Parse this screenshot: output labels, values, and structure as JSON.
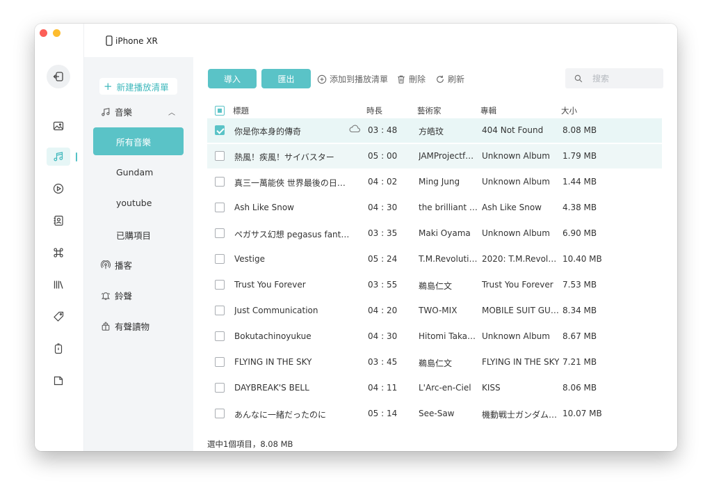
{
  "device": {
    "name": "iPhone XR"
  },
  "sidebar": {
    "new_playlist": "新建播放清單",
    "music": "音樂",
    "all_music": "所有音樂",
    "playlists": [
      "Gundam",
      "youtube",
      "已購項目"
    ],
    "podcasts": "播客",
    "ringtones": "鈴聲",
    "audiobooks": "有聲讀物"
  },
  "toolbar": {
    "import_label": "導入",
    "export_label": "匯出",
    "add_to_playlist": "添加到播放清單",
    "delete": "刪除",
    "refresh": "刷新",
    "search_placeholder": "搜索"
  },
  "table": {
    "columns": {
      "title": "標題",
      "duration": "時長",
      "artist": "藝術家",
      "album": "專輯",
      "size": "大小"
    },
    "rows": [
      {
        "title": "你是你本身的傳奇",
        "duration": "03 : 48",
        "artist": "方皓玟",
        "album": "404 Not Found",
        "size": "8.08 MB",
        "checked": true,
        "cloud": true
      },
      {
        "title": "熱風！疾風！サイバスター",
        "duration": "05 : 00",
        "artist": "JAMProjectf…",
        "album": "Unknown Album",
        "size": "1.79 MB",
        "checked": false
      },
      {
        "title": "真三一萬能俠 世界最後の日…",
        "duration": "04 : 02",
        "artist": "Ming Jung",
        "album": "Unknown Album",
        "size": "1.44 MB",
        "checked": false
      },
      {
        "title": "Ash Like Snow",
        "duration": "04 : 30",
        "artist": "the brilliant g…",
        "album": "Ash Like Snow",
        "size": "4.38 MB",
        "checked": false
      },
      {
        "title": "ペガサス幻想 pegasus fanta…",
        "duration": "03 : 35",
        "artist": "Maki Oyama",
        "album": "Unknown Album",
        "size": "6.90 MB",
        "checked": false
      },
      {
        "title": "Vestige",
        "duration": "05 : 24",
        "artist": "T.M.Revolution",
        "album": "2020: T.M.Revolut…",
        "size": "10.40 MB",
        "checked": false
      },
      {
        "title": "Trust You Forever",
        "duration": "03 : 55",
        "artist": "鵜島仁文",
        "album": "Trust You Forever",
        "size": "7.53 MB",
        "checked": false
      },
      {
        "title": "Just Communication",
        "duration": "04 : 20",
        "artist": "TWO-MIX",
        "album": "MOBILE SUIT GU…",
        "size": "8.34 MB",
        "checked": false
      },
      {
        "title": "Bokutachinoyukue",
        "duration": "04 : 30",
        "artist": "Hitomi Takah…",
        "album": "Unknown Album",
        "size": "8.67 MB",
        "checked": false
      },
      {
        "title": "FLYING IN THE SKY",
        "duration": "03 : 45",
        "artist": "鵜島仁文",
        "album": "FLYING IN THE SKY",
        "size": "7.21 MB",
        "checked": false
      },
      {
        "title": "DAYBREAK'S BELL",
        "duration": "04 : 11",
        "artist": "L'Arc-en-Ciel",
        "album": "KISS",
        "size": "8.06 MB",
        "checked": false
      },
      {
        "title": "あんなに一緒だったのに",
        "duration": "05 : 14",
        "artist": "See-Saw",
        "album": "機動戦士ガンダム…",
        "size": "10.07 MB",
        "checked": false
      }
    ]
  },
  "status": {
    "text": "選中1個項目，8.08 MB"
  },
  "colors": {
    "accent": "#5ac3c7",
    "sidebar_bg": "#f3f5f7",
    "selected_row": "#e9f6f6"
  }
}
